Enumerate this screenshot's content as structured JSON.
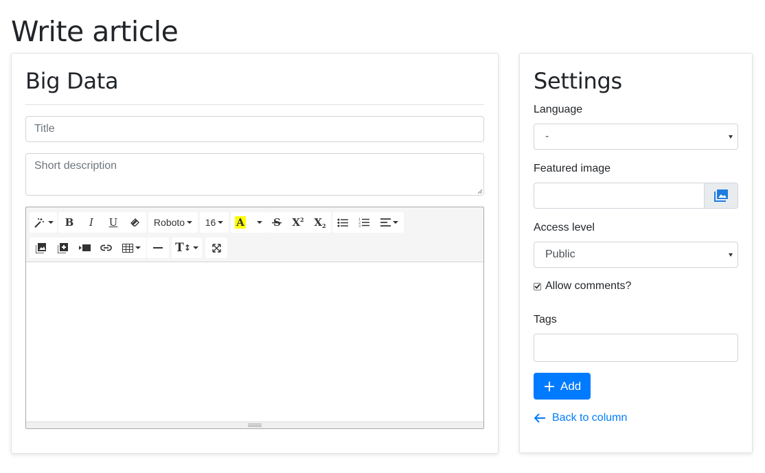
{
  "page": {
    "title": "Write article"
  },
  "editor_card": {
    "heading": "Big Data",
    "title_placeholder": "Title",
    "description_placeholder": "Short description",
    "toolbar": {
      "font_name": "Roboto",
      "font_size": "16",
      "color_letter": "A",
      "bold": "B",
      "italic": "I",
      "underline": "U",
      "superscript": "X",
      "subscript": "X",
      "height_label": "T"
    }
  },
  "settings": {
    "heading": "Settings",
    "language_label": "Language",
    "language_value": "-",
    "featured_image_label": "Featured image",
    "access_level_label": "Access level",
    "access_level_value": "Public",
    "allow_comments_label": "Allow comments?",
    "allow_comments_checked": true,
    "tags_label": "Tags",
    "add_button_label": "Add",
    "back_link_label": "Back to column"
  },
  "colors": {
    "primary": "#007bff",
    "highlight": "#ffff00"
  },
  "icons": [
    "magic-wand-icon",
    "eraser-icon",
    "strikethrough-icon",
    "unordered-list-icon",
    "ordered-list-icon",
    "align-icon",
    "picture-icon",
    "video-icon",
    "link-icon",
    "table-icon",
    "horizontal-rule-icon",
    "fullscreen-icon",
    "image-icon",
    "plus-icon",
    "arrow-left-icon"
  ]
}
